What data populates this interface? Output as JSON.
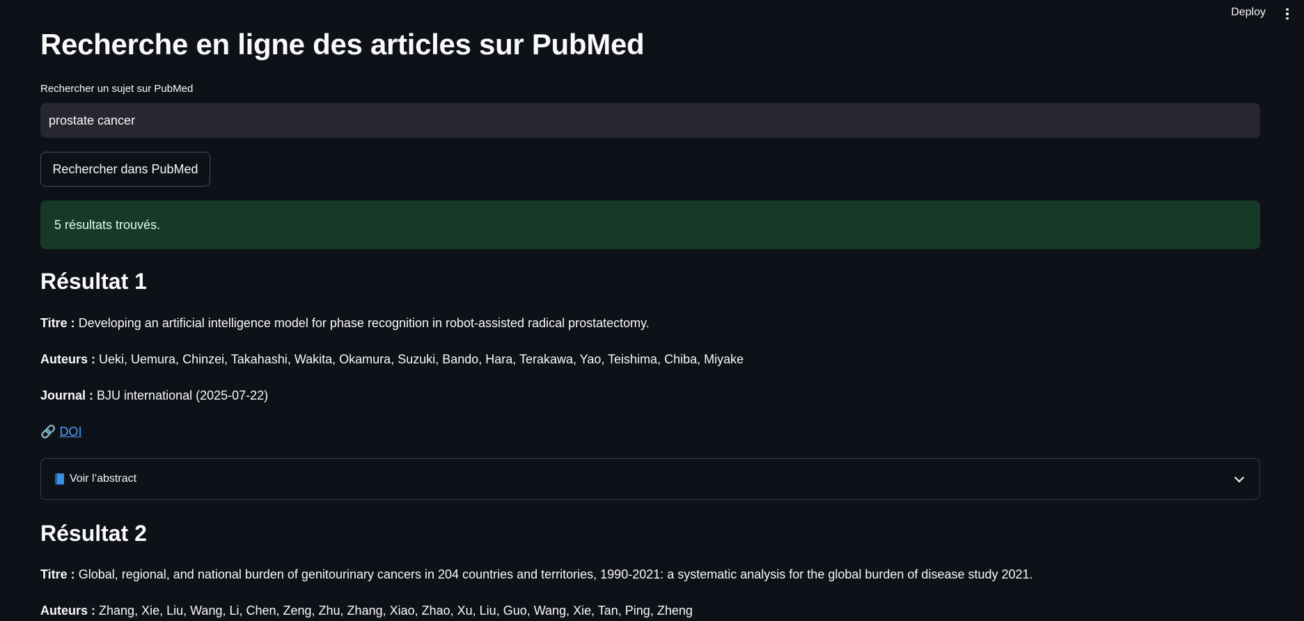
{
  "header": {
    "deploy_label": "Deploy"
  },
  "page": {
    "title": "Recherche en ligne des articles sur PubMed",
    "search_label": "Rechercher un sujet sur PubMed",
    "search_value": "prostate cancer",
    "search_button": "Rechercher dans PubMed",
    "success_message": "5 résultats trouvés."
  },
  "labels": {
    "titre": "Titre :",
    "auteurs": "Auteurs :",
    "journal": "Journal :",
    "doi": "DOI",
    "abstract": "Voir l’abstract"
  },
  "results": [
    {
      "heading": "Résultat 1",
      "title": "Developing an artificial intelligence model for phase recognition in robot-assisted radical prostatectomy.",
      "authors": "Ueki, Uemura, Chinzei, Takahashi, Wakita, Okamura, Suzuki, Bando, Hara, Terakawa, Yao, Teishima, Chiba, Miyake",
      "journal": "BJU international (2025-07-22)"
    },
    {
      "heading": "Résultat 2",
      "title": "Global, regional, and national burden of genitourinary cancers in 204 countries and territories, 1990-2021: a systematic analysis for the global burden of disease study 2021.",
      "authors": "Zhang, Xie, Liu, Wang, Li, Chen, Zeng, Zhu, Zhang, Xiao, Zhao, Xu, Liu, Guo, Wang, Xie, Tan, Ping, Zheng"
    }
  ]
}
